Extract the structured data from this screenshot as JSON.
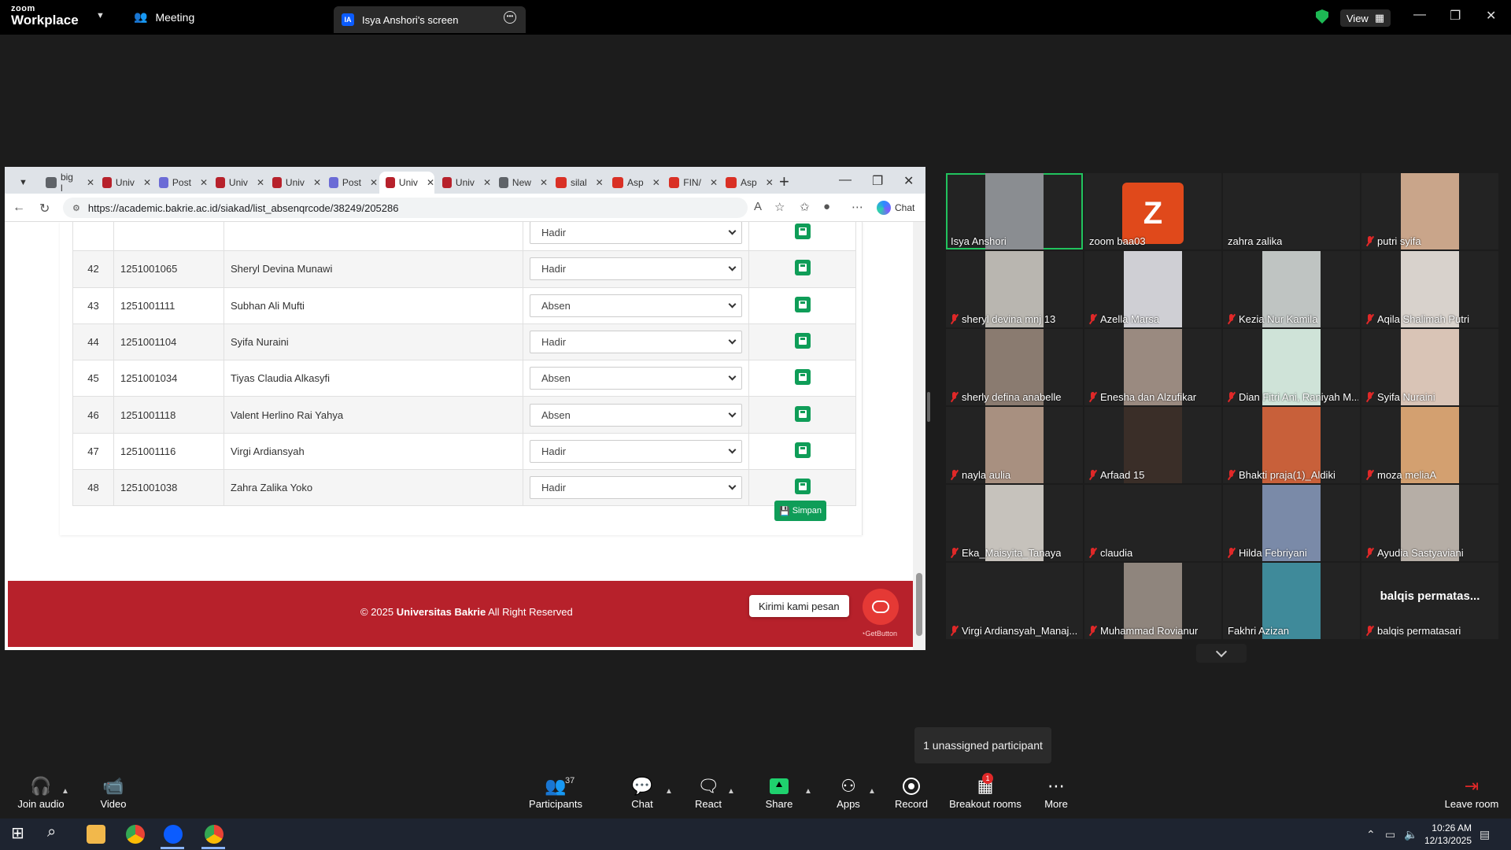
{
  "zoom": {
    "brand_top": "zoom",
    "brand_bottom": "Workplace",
    "meeting_label": "Meeting",
    "share_badge": "IA",
    "share_tab": "Isya Anshori's screen",
    "view_label": "View",
    "accent": "#0b5cff"
  },
  "browser": {
    "tabs": [
      {
        "label": "big l",
        "icon": "search-icon",
        "color": "#5f6368"
      },
      {
        "label": "Univ",
        "icon": "shield-icon",
        "color": "#b7212b"
      },
      {
        "label": "Post",
        "icon": "globe-icon",
        "color": "#6b6bd6"
      },
      {
        "label": "Univ",
        "icon": "shield-icon",
        "color": "#b7212b"
      },
      {
        "label": "Univ",
        "icon": "shield-icon",
        "color": "#b7212b"
      },
      {
        "label": "Post",
        "icon": "globe-icon",
        "color": "#6b6bd6"
      },
      {
        "label": "Univ",
        "icon": "shield-icon",
        "color": "#b7212b"
      },
      {
        "label": "Univ",
        "icon": "shield-icon",
        "color": "#b7212b"
      },
      {
        "label": "New",
        "icon": "page-icon",
        "color": "#5f6368"
      },
      {
        "label": "silal",
        "icon": "gmail-icon",
        "color": "#d93025"
      },
      {
        "label": "Asp",
        "icon": "pdf-icon",
        "color": "#d93025"
      },
      {
        "label": "FIN/",
        "icon": "pdf-icon",
        "color": "#d93025"
      },
      {
        "label": "Asp",
        "icon": "pdf-icon",
        "color": "#d93025"
      }
    ],
    "url": "https://academic.bakrie.ac.id/siakad/list_absenqrcode/38249/205286",
    "chat_label": "Chat"
  },
  "attendance": {
    "rows": [
      {
        "no": "",
        "nim": "",
        "name": "",
        "status": "Hadir"
      },
      {
        "no": "42",
        "nim": "1251001065",
        "name": "Sheryl Devina Munawi",
        "status": "Hadir"
      },
      {
        "no": "43",
        "nim": "1251001111",
        "name": "Subhan Ali Mufti",
        "status": "Absen"
      },
      {
        "no": "44",
        "nim": "1251001104",
        "name": "Syifa Nuraini",
        "status": "Hadir"
      },
      {
        "no": "45",
        "nim": "1251001034",
        "name": "Tiyas Claudia Alkasyfi",
        "status": "Absen"
      },
      {
        "no": "46",
        "nim": "1251001118",
        "name": "Valent Herlino Rai Yahya",
        "status": "Absen"
      },
      {
        "no": "47",
        "nim": "1251001116",
        "name": "Virgi Ardiansyah",
        "status": "Hadir"
      },
      {
        "no": "48",
        "nim": "1251001038",
        "name": "Zahra Zalika Yoko",
        "status": "Hadir"
      }
    ],
    "save_all": "Simpan"
  },
  "footer": {
    "copy_prefix": "© 2025",
    "copy_brand": "Universitas Bakrie",
    "copy_suffix": "All Right Reserved",
    "chat_pill": "Kirimi kami pesan",
    "getbutton": "GetButton",
    "color": "#b7212b"
  },
  "participants": [
    {
      "name": "Isya Anshori",
      "muted": false,
      "speaking": true,
      "bg": "#8a8d91"
    },
    {
      "name": "zoom baa03",
      "muted": false,
      "avatar": "Z"
    },
    {
      "name": "zahra zalika",
      "muted": false,
      "bg": "#232323"
    },
    {
      "name": "putri syifa",
      "muted": true,
      "bg": "#c9a58a"
    },
    {
      "name": "sheryl devina mnj 13",
      "muted": true,
      "bg": "#b9b6b0"
    },
    {
      "name": "Azella Marsa",
      "muted": true,
      "bg": "#cfcfd4"
    },
    {
      "name": "Kezia Nur Kamila",
      "muted": true,
      "bg": "#bfc4c2"
    },
    {
      "name": "Aqila Shalimah Putri",
      "muted": true,
      "bg": "#d8d2cc"
    },
    {
      "name": "sherly defina anabelle",
      "muted": true,
      "bg": "#8a7b70"
    },
    {
      "name": "Enesha dan Alzufikar",
      "muted": true,
      "bg": "#9a8a80"
    },
    {
      "name": "Dian Fitri Ani, Raniyah M...",
      "muted": true,
      "bg": "#cfe3d8"
    },
    {
      "name": "Syifa Nuraini",
      "muted": true,
      "bg": "#d9c4b6"
    },
    {
      "name": "nayla aulia",
      "muted": true,
      "bg": "#a89080"
    },
    {
      "name": "Arfaad 15",
      "muted": true,
      "bg": "#3a2e28"
    },
    {
      "name": "Bhakti praja(1)_Aldiki",
      "muted": true,
      "bg": "#c8603a"
    },
    {
      "name": "moza meliaA",
      "muted": true,
      "bg": "#d3a070"
    },
    {
      "name": "Eka_Maisyita_Tanaya",
      "muted": true,
      "bg": "#c6c2bc"
    },
    {
      "name": "claudia",
      "muted": true,
      "bg": "#232323"
    },
    {
      "name": "Hilda Febriyani",
      "muted": true,
      "bg": "#7a8aa8"
    },
    {
      "name": "Ayudia Sastyaviani",
      "muted": true,
      "bg": "#b6aea6"
    },
    {
      "name": "Virgi Ardiansyah_Manaj...",
      "muted": true,
      "bg": "#232323"
    },
    {
      "name": "Muhammad Rovianur",
      "muted": true,
      "bg": "#8f857d"
    },
    {
      "name": "Fakhri Azizan",
      "muted": false,
      "bg": "#3f8a9a"
    },
    {
      "name": "balqis permatasari",
      "muted": true,
      "bg": "#232323",
      "bigname": "balqis permatas..."
    }
  ],
  "unassigned": "1 unassigned participant",
  "toolbar": {
    "join_audio": "Join audio",
    "video": "Video",
    "participants": "Participants",
    "participants_count": "37",
    "chat": "Chat",
    "react": "React",
    "share": "Share",
    "apps": "Apps",
    "record": "Record",
    "breakout": "Breakout rooms",
    "breakout_badge": "1",
    "more": "More",
    "leave": "Leave room"
  },
  "taskbar": {
    "time": "10:26 AM",
    "date": "12/13/2025"
  }
}
